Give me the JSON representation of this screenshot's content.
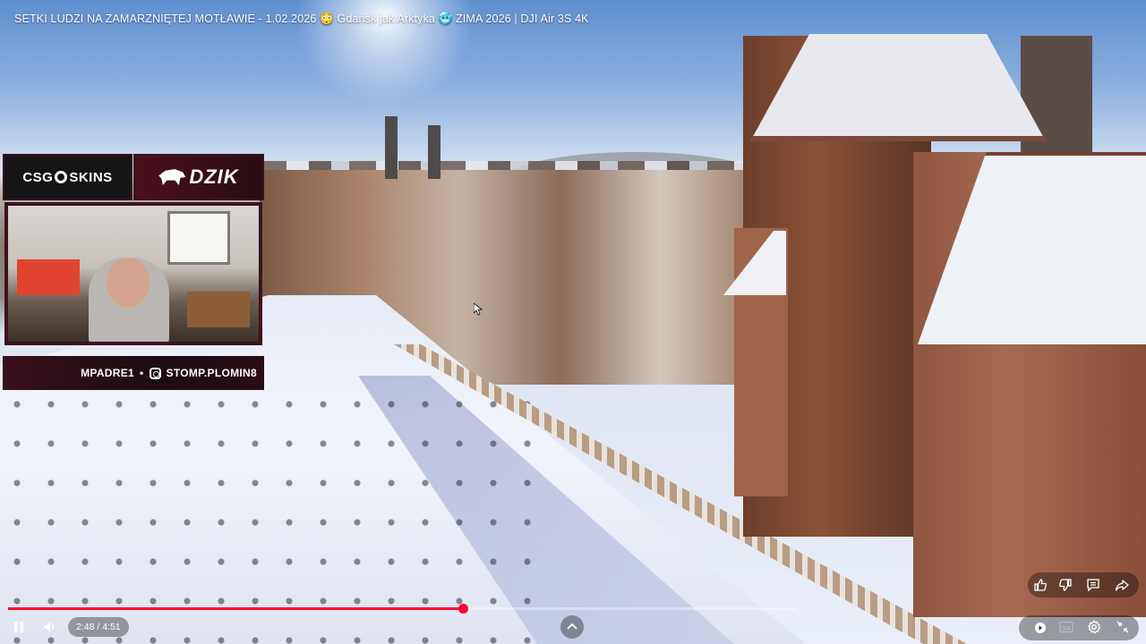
{
  "video": {
    "title": "SETKI LUDZI NA ZAMARZNIĘTEJ MOTŁAWIE - 1.02.2026 😳 Gdańsk jak Arktyka 🥶  ZIMA 2026 | DJI Air 3S 4K"
  },
  "overlay": {
    "sponsor_left": "CSG",
    "sponsor_left_suffix": "SKINS",
    "sponsor_right": "DZIK",
    "bar_left_text": "MPADRE1",
    "bar_separator": "•",
    "bar_right_text": "STOMP.PLOMIN8"
  },
  "player": {
    "current_time": "2:48",
    "duration": "4:51",
    "time_display": "2:48 / 4:51",
    "progress_fraction": 0.577,
    "accent_color": "#ff0033",
    "icons": {
      "play_pause": "pause-icon",
      "volume": "volume-icon",
      "expand": "chevron-up-icon",
      "like": "thumbs-up-icon",
      "dislike": "thumbs-down-icon",
      "comments": "comment-icon",
      "share": "share-icon",
      "autoplay": "autoplay-toggle-icon",
      "captions": "captions-icon",
      "settings": "gear-icon",
      "fullscreen": "exit-fullscreen-icon"
    }
  }
}
